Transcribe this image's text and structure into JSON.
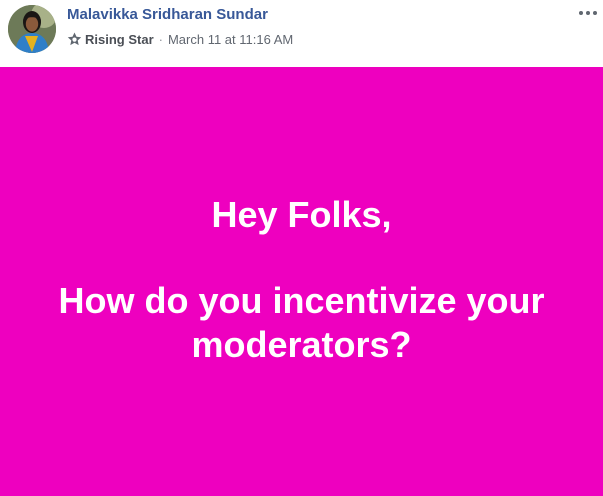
{
  "post": {
    "author": {
      "name": "Malavikka Sridharan Sundar"
    },
    "badge": {
      "icon": "star-badge-icon",
      "label": "Rising Star"
    },
    "separator": "·",
    "timestamp": "March 11 at 11:16 AM",
    "more_icon": "more-options-icon",
    "content": {
      "background_color": "#ee00bf",
      "text_color": "#ffffff",
      "greeting": "Hey Folks,",
      "question": "How do you incentivize your moderators?"
    }
  }
}
